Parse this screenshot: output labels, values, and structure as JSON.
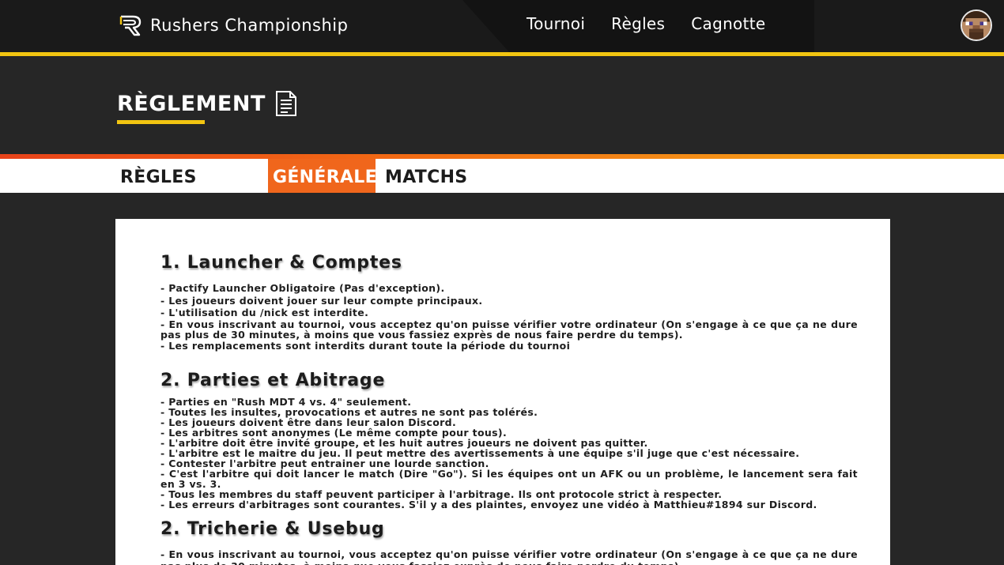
{
  "header": {
    "brand": "Rushers Championship",
    "nav": [
      "Tournoi",
      "Règles",
      "Cagnotte"
    ]
  },
  "page": {
    "title": "RÈGLEMENT"
  },
  "tabs": [
    "RÈGLES",
    "GÉNÉRALES",
    "MATCHS"
  ],
  "sections": [
    {
      "title": "1. Launcher & Comptes",
      "rules": [
        "- Pactify Launcher Obligatoire (Pas d'exception).",
        "- Les joueurs doivent jouer sur leur compte principaux.",
        "- L'utilisation du /nick est interdite.",
        "- En vous inscrivant au tournoi, vous acceptez qu'on puisse vérifier votre ordinateur (On s'engage à ce que ça ne dure pas plus de 30 minutes, à moins que vous fassiez exprès de nous faire perdre du temps).",
        "- Les remplacements sont interdits durant toute la période du tournoi"
      ]
    },
    {
      "title": "2. Parties et Abitrage",
      "rules": [
        "- Parties en \"Rush MDT 4 vs. 4\" seulement.",
        "- Toutes les insultes, provocations et autres ne sont pas tolérés.",
        "- Les joueurs doivent être dans leur salon Discord.",
        "- Les arbitres sont anonymes (Le même compte pour tous).",
        "- L'arbitre doit être invité groupe, et les huit autres joueurs ne doivent pas quitter.",
        "- L'arbitre est le maitre du jeu. Il peut mettre des avertissements à une équipe s'il juge que c'est nécessaire.",
        "- Contester l'arbitre peut entrainer une lourde sanction.",
        "- C'est l'arbitre qui doit lancer le match (Dire \"Go\"). Si les équipes ont un AFK ou un problème, le lancement sera fait en 3 vs. 3.",
        "- Tous les membres du staff peuvent participer à l'arbitrage. Ils ont protocole strict à respecter.",
        "- Les erreurs d'arbitrages sont courantes. S'il y a des plaintes, envoyez une vidéo à Matthieu#1894 sur Discord."
      ]
    },
    {
      "title": "2. Tricherie & Usebug",
      "rules": [
        "- En vous inscrivant au tournoi, vous acceptez qu'on puisse vérifier votre ordinateur (On s'engage à ce que ça ne dure pas plus de 30 minutes, à moins que vous fassiez exprès de nous faire perdre du temps)."
      ]
    }
  ],
  "colors": {
    "accent_yellow": "#f2c511",
    "accent_orange": "#f0661c",
    "navbar": "#1a1a1a",
    "background": "#262626"
  },
  "icons": {
    "brand": "rushers-logo-icon",
    "title": "document-icon",
    "avatar": "player-head-avatar"
  }
}
